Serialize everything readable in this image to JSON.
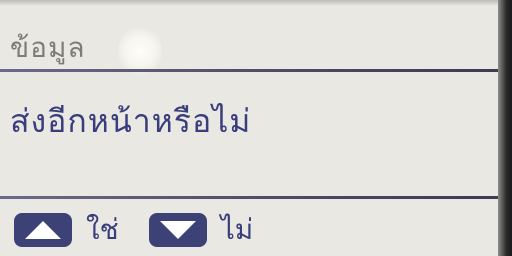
{
  "header": {
    "title": "ข้อมูล"
  },
  "dialog": {
    "message": "ส่งอีกหน้าหรือไม่"
  },
  "footer": {
    "up_icon": "triangle-up-icon",
    "yes_label": "ใช่",
    "down_icon": "triangle-down-icon",
    "no_label": "ไม่"
  },
  "colors": {
    "screen_bg": "#e9e8e3",
    "text": "#3a3d7c",
    "header_text": "#7c7c78",
    "button_bg": "#3c4176"
  }
}
